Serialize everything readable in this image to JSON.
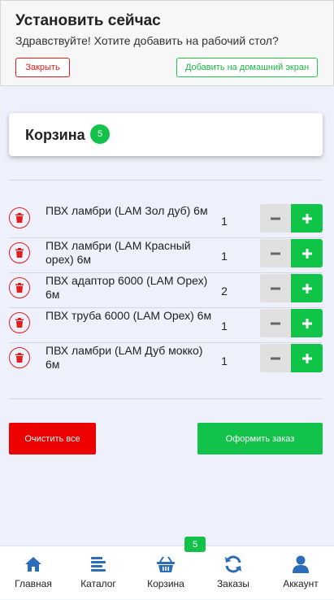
{
  "install_banner": {
    "title": "Установить сейчас",
    "text": "Здравствуйте! Хотите добавить на рабочий стол?",
    "close_label": "Закрыть",
    "add_label": "Добавить на домашний экран"
  },
  "cart": {
    "title": "Корзина",
    "count": "5",
    "items": [
      {
        "name": "ПВХ ламбри (LAM Зол дуб) 6м",
        "qty": "1"
      },
      {
        "name": "ПВХ ламбри (LAM Красный орех) 6м",
        "qty": "1"
      },
      {
        "name": "ПВХ адаптор 6000 (LAM Орех) 6м",
        "qty": "2"
      },
      {
        "name": "ПВХ труба 6000 (LAM Орех) 6м",
        "qty": "1"
      },
      {
        "name": "ПВХ ламбри (LAM Дуб мокко) 6м",
        "qty": "1"
      }
    ],
    "clear_label": "Очистить все",
    "order_label": "Оформить заказ"
  },
  "nav": {
    "badge": "5",
    "items": [
      {
        "label": "Главная",
        "icon": "home-icon"
      },
      {
        "label": "Каталог",
        "icon": "catalog-icon"
      },
      {
        "label": "Корзина",
        "icon": "basket-icon"
      },
      {
        "label": "Заказы",
        "icon": "orders-icon"
      },
      {
        "label": "Аккаунт",
        "icon": "user-icon"
      }
    ]
  },
  "colors": {
    "accent_green": "#12c24a",
    "danger_red": "#e01e1e",
    "nav_blue": "#2c6dbb",
    "background": "#eef0fb"
  }
}
